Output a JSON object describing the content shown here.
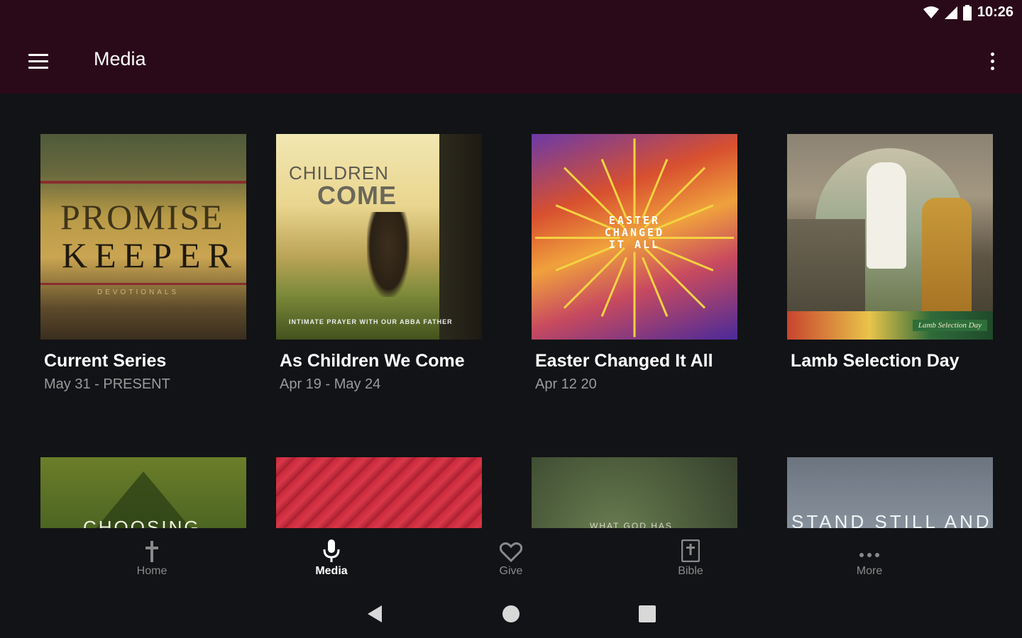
{
  "status": {
    "time": "10:26"
  },
  "app_bar": {
    "title": "Media"
  },
  "series": [
    {
      "title": "Current Series",
      "subtitle": "May 31 - PRESENT",
      "art_text": [
        "PROMISE",
        "KEEPER",
        "DEVOTIONALS"
      ]
    },
    {
      "title": "As Children We Come",
      "subtitle": "Apr 19 - May 24",
      "art_text": [
        "CHILDREN",
        "COME",
        "INTIMATE PRAYER WITH OUR ABBA FATHER"
      ]
    },
    {
      "title": "Easter Changed It All",
      "subtitle": "Apr 12 20",
      "art_text": [
        "EASTER CHANGED IT ALL"
      ]
    },
    {
      "title": "Lamb Selection Day",
      "subtitle": "",
      "art_text": [
        "Lamb Selection Day"
      ]
    },
    {
      "title": "",
      "subtitle": "",
      "art_text": [
        "CHOOSING"
      ]
    },
    {
      "title": "",
      "subtitle": "",
      "art_text": []
    },
    {
      "title": "",
      "subtitle": "",
      "art_text": [
        "WHAT GOD HAS"
      ]
    },
    {
      "title": "",
      "subtitle": "",
      "art_text": [
        "STAND STILL AND SEE"
      ]
    }
  ],
  "bottom_nav": [
    {
      "label": "Home",
      "icon": "cross-icon"
    },
    {
      "label": "Media",
      "icon": "microphone-icon",
      "active": true
    },
    {
      "label": "Give",
      "icon": "heart-icon"
    },
    {
      "label": "Bible",
      "icon": "bible-icon"
    },
    {
      "label": "More",
      "icon": "more-dots-icon"
    }
  ],
  "colors": {
    "app_bar": "#2a0a18",
    "background": "#121316",
    "subtitle": "#9a9a9a"
  }
}
